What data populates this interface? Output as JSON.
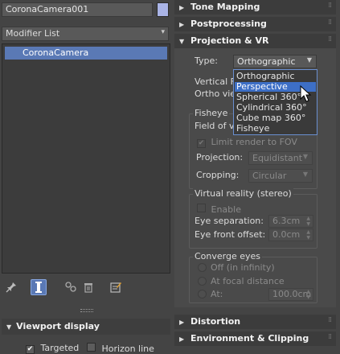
{
  "left": {
    "object_name": "CoronaCamera001",
    "swatch_color": "#aab4e6",
    "modifier_list": "Modifier List",
    "stack_items": [
      "CoronaCamera"
    ],
    "toolbar_icons": [
      "pin-stack-icon",
      "show-end-result-icon",
      "make-unique-icon",
      "remove-modifier-icon",
      "configure-modifier-sets-icon"
    ],
    "viewport_display": {
      "title": "Viewport display",
      "targeted_label": "Targeted",
      "targeted_checked": true,
      "horizon_label": "Horizon line",
      "horizon_checked": false
    }
  },
  "right": {
    "rollouts_top": [
      {
        "label": "Tone Mapping",
        "expanded": false
      },
      {
        "label": "Postprocessing",
        "expanded": false
      },
      {
        "label": "Projection & VR",
        "expanded": true
      }
    ],
    "type_label": "Type:",
    "type_value": "Orthographic",
    "vertical_label": "Vertical F",
    "ortho_label": "Ortho vie",
    "fisheye_title": "Fisheye",
    "fov_label": "Field of vi",
    "limit_render_label": "Limit render to FOV",
    "projection_label": "Projection:",
    "projection_value": "Equidistant",
    "cropping_label": "Cropping:",
    "cropping_value": "Circular",
    "vr_title": "Virtual reality (stereo)",
    "enable_label": "Enable",
    "eye_sep_label": "Eye separation:",
    "eye_sep_value": "6.3cm",
    "eye_front_label": "Eye front offset:",
    "eye_front_value": "0.0cm",
    "converge_title": "Converge eyes",
    "converge_options": [
      "Off (in infinity)",
      "At focal distance",
      "At:"
    ],
    "converge_at_value": "100.0cm",
    "type_options": [
      "Orthographic",
      "Perspective",
      "Spherical 360°",
      "Cylindrical 360°",
      "Cube map 360°",
      "Fisheye"
    ],
    "type_highlighted": "Perspective",
    "rollouts_bottom": [
      {
        "label": "Distortion",
        "expanded": false
      },
      {
        "label": "Environment & Clipping",
        "expanded": false
      }
    ]
  }
}
